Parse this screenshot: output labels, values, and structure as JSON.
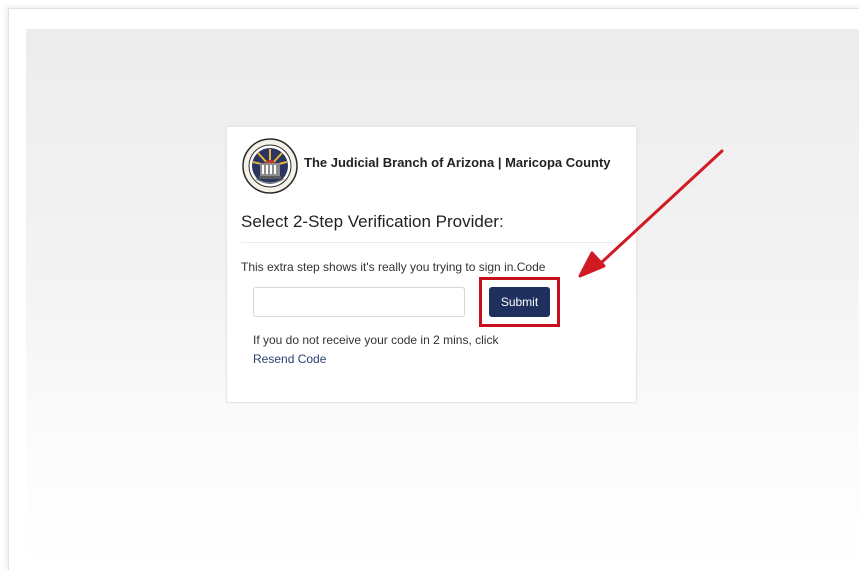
{
  "organization": {
    "name": "The Judicial Branch of Arizona | Maricopa County",
    "seal_icon": "court-seal-icon"
  },
  "verification": {
    "heading": "Select 2-Step Verification Provider:",
    "description": "This extra step shows it's really you trying to sign in.Code",
    "code_input_value": "",
    "code_input_placeholder": "",
    "submit_label": "Submit",
    "help_text": "If you do not receive your code in 2 mins, click",
    "resend_label": "Resend Code"
  },
  "annotation": {
    "arrow_icon": "red-arrow-icon",
    "highlight_color": "#c80f1e"
  },
  "colors": {
    "primary_button": "#1f2f5e",
    "link": "#2b3f73"
  }
}
